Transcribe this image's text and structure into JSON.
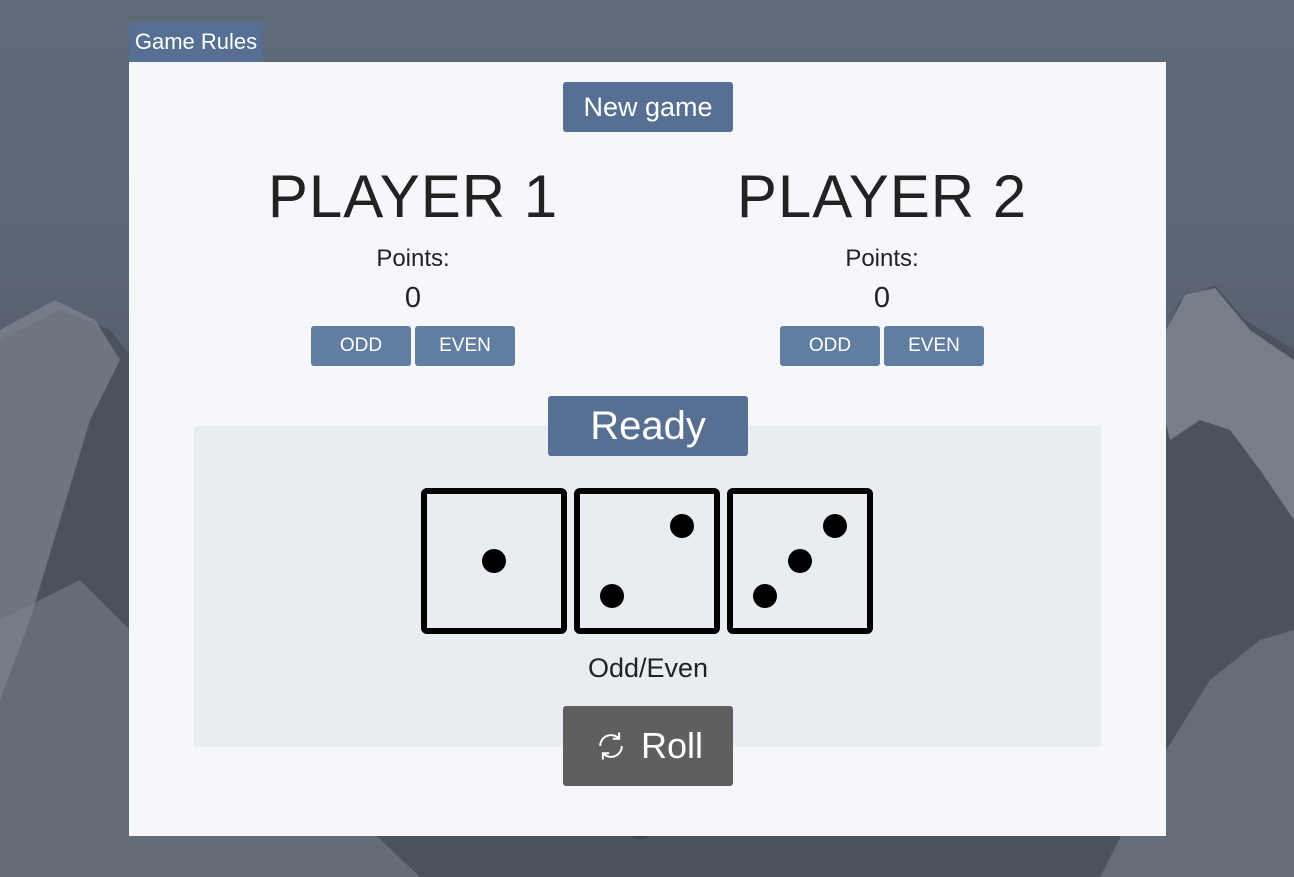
{
  "header": {
    "rules_tab": "Game Rules"
  },
  "controls": {
    "new_game": "New game",
    "roll": "Roll",
    "roll_icon": "refresh-icon"
  },
  "players": [
    {
      "name": "PLAYER 1",
      "points_label": "Points:",
      "points": "0",
      "odd": "ODD",
      "even": "EVEN"
    },
    {
      "name": "PLAYER 2",
      "points_label": "Points:",
      "points": "0",
      "odd": "ODD",
      "even": "EVEN"
    }
  ],
  "board": {
    "status": "Ready",
    "mode": "Odd/Even"
  },
  "dice": [
    1,
    2,
    3
  ],
  "colors": {
    "accent": "#566f92",
    "bet_button": "#617d9f",
    "roll_button": "#5f5f5f",
    "panel": "#f5f7fa",
    "board": "#e9ecf1"
  }
}
